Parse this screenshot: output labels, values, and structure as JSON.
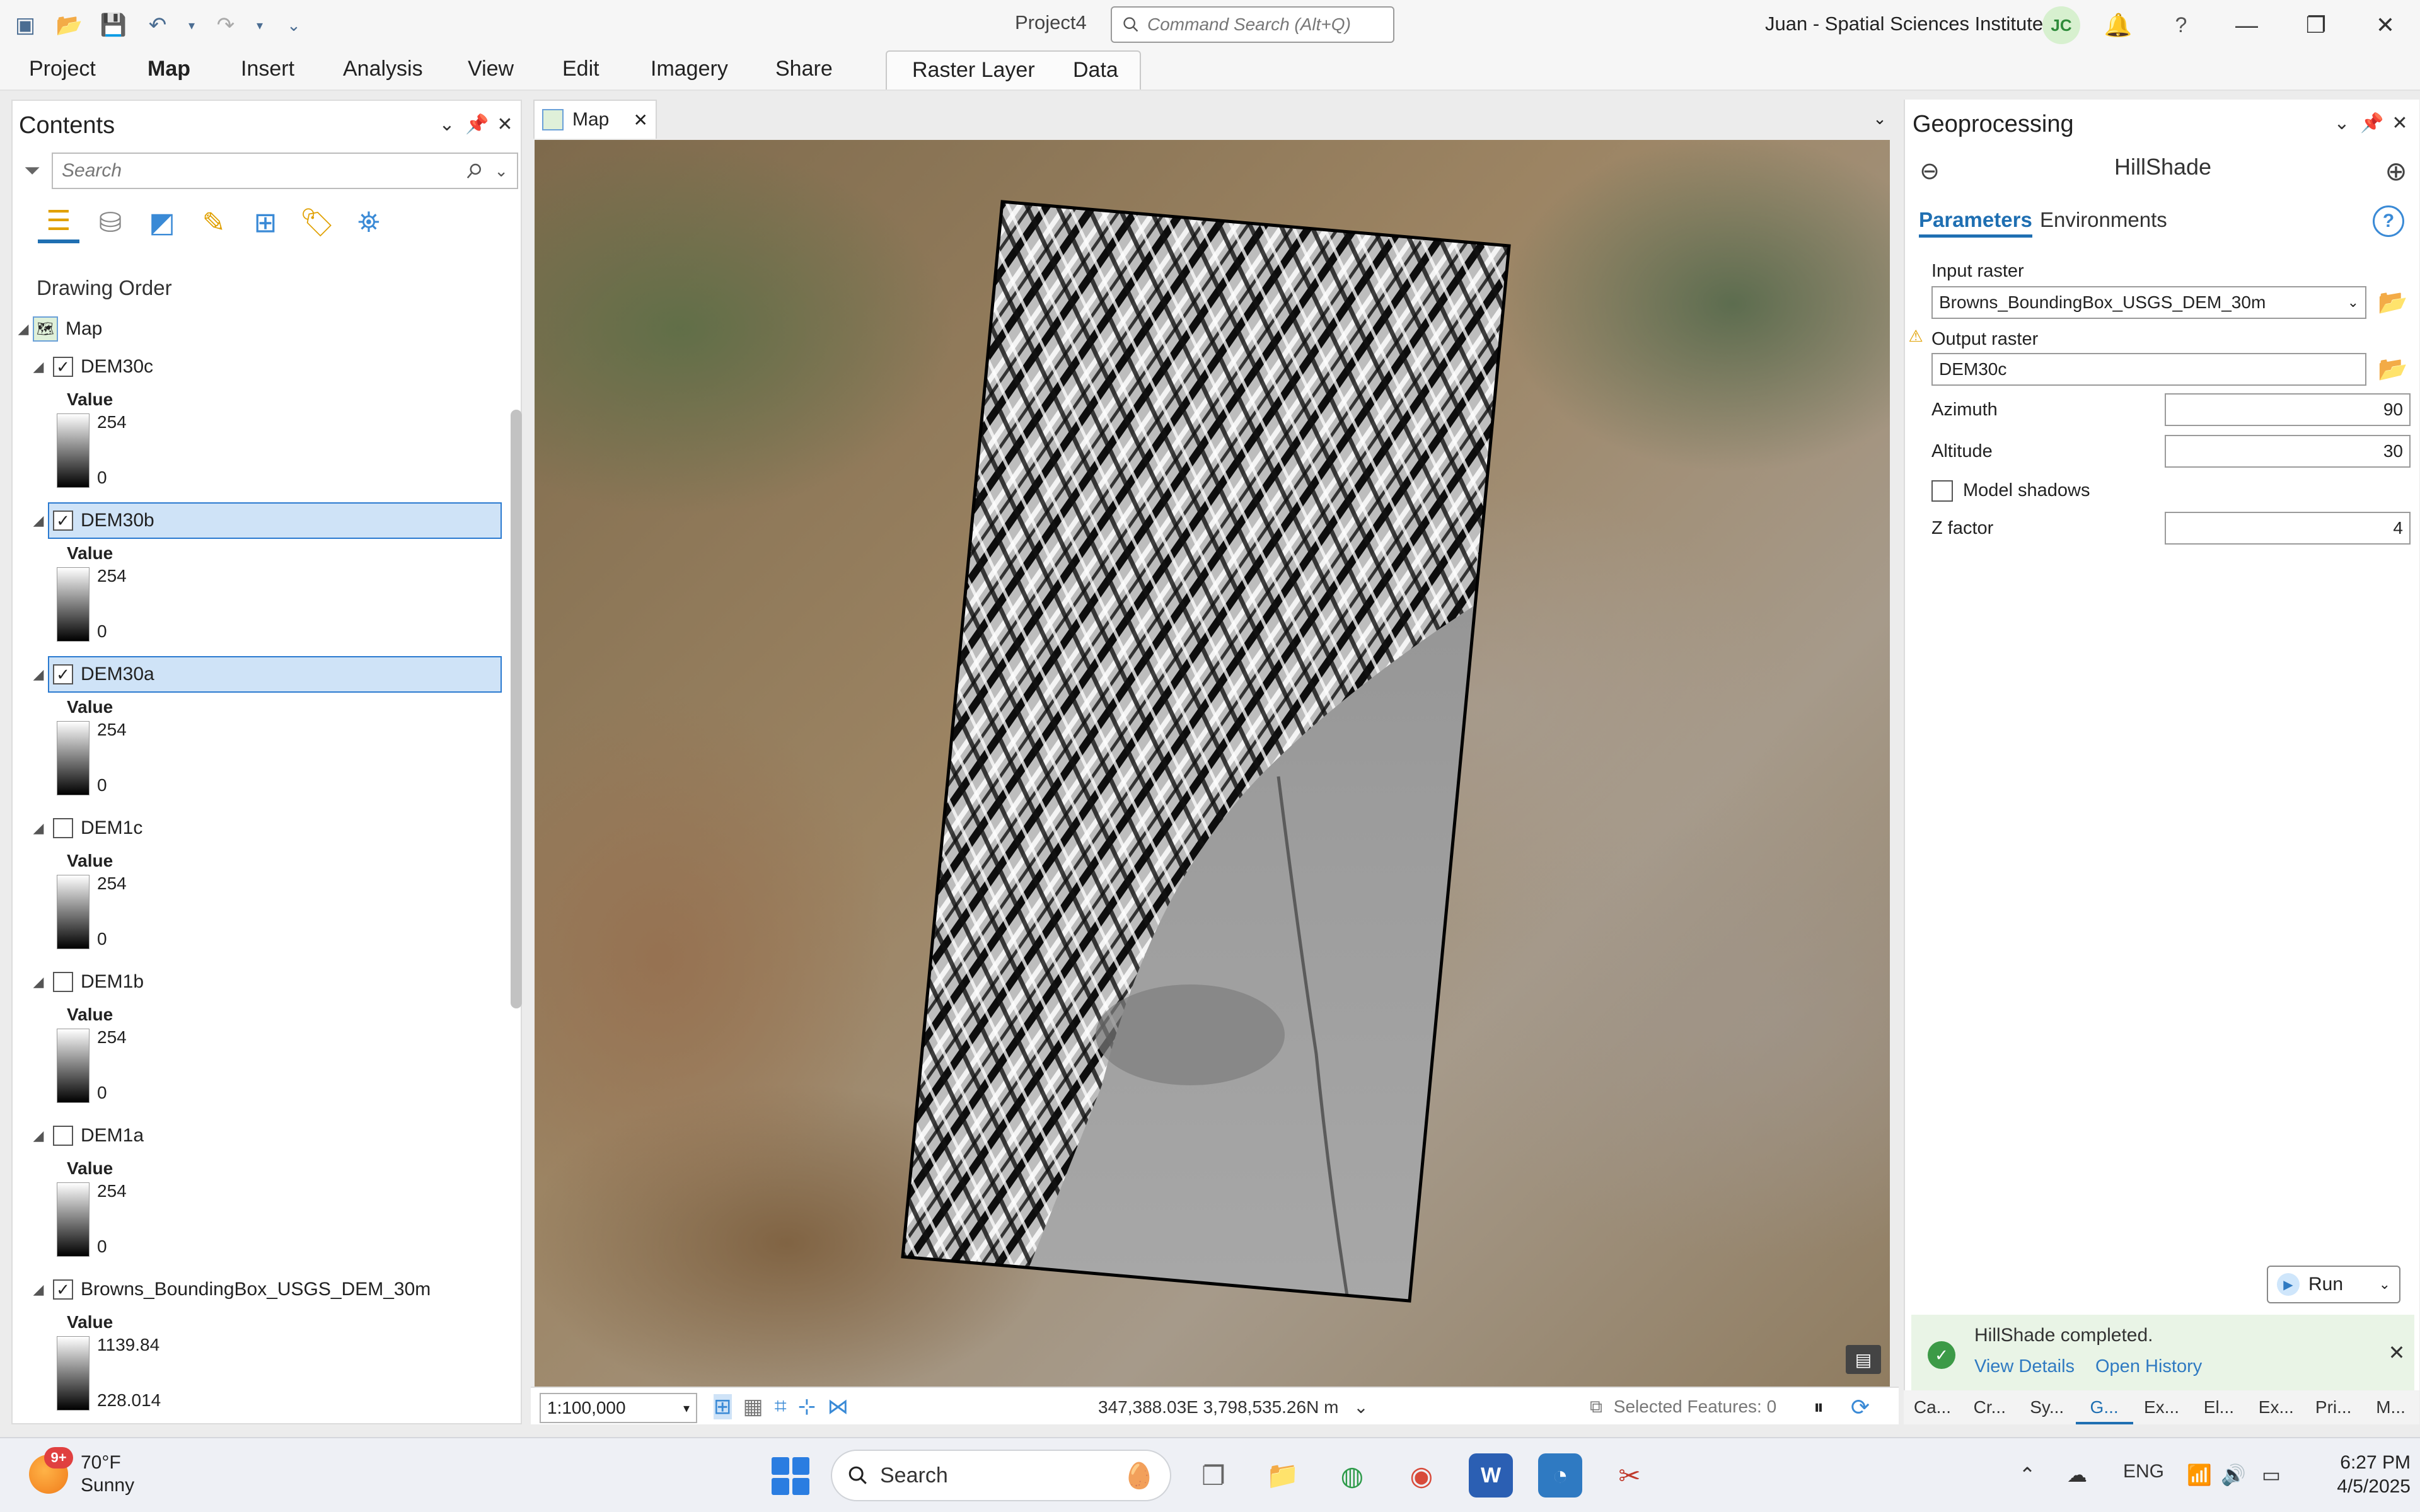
{
  "window": {
    "project_name": "Project4",
    "command_search_placeholder": "Command Search (Alt+Q)",
    "user": "Juan - Spatial Sciences Institute",
    "avatar_initials": "JC"
  },
  "ribbon": {
    "tabs": [
      "Project",
      "Map",
      "Insert",
      "Analysis",
      "View",
      "Edit",
      "Imagery",
      "Share"
    ],
    "contextual_tabs": [
      "Raster Layer",
      "Data"
    ],
    "active": "Map"
  },
  "contents": {
    "title": "Contents",
    "search_placeholder": "Search",
    "section": "Drawing Order",
    "root": "Map",
    "layers": [
      {
        "name": "DEM30c",
        "checked": true,
        "selected": false,
        "legend_label": "Value",
        "high": "254",
        "low": "0"
      },
      {
        "name": "DEM30b",
        "checked": true,
        "selected": true,
        "legend_label": "Value",
        "high": "254",
        "low": "0"
      },
      {
        "name": "DEM30a",
        "checked": true,
        "selected": true,
        "legend_label": "Value",
        "high": "254",
        "low": "0"
      },
      {
        "name": "DEM1c",
        "checked": false,
        "selected": false,
        "legend_label": "Value",
        "high": "254",
        "low": "0"
      },
      {
        "name": "DEM1b",
        "checked": false,
        "selected": false,
        "legend_label": "Value",
        "high": "254",
        "low": "0"
      },
      {
        "name": "DEM1a",
        "checked": false,
        "selected": false,
        "legend_label": "Value",
        "high": "254",
        "low": "0"
      },
      {
        "name": "Browns_BoundingBox_USGS_DEM_30m",
        "checked": true,
        "selected": false,
        "legend_label": "Value",
        "high": "1139.84",
        "low": "228.014"
      }
    ]
  },
  "map": {
    "tab_label": "Map",
    "scale": "1:100,000",
    "coordinates": "347,388.03E 3,798,535.26N m",
    "selected_features": "Selected Features: 0"
  },
  "geoprocessing": {
    "title": "Geoprocessing",
    "tool": "HillShade",
    "tab_parameters": "Parameters",
    "tab_environments": "Environments",
    "input_raster_label": "Input raster",
    "input_raster_value": "Browns_BoundingBox_USGS_DEM_30m",
    "output_raster_label": "Output raster",
    "output_raster_value": "DEM30c",
    "azimuth_label": "Azimuth",
    "azimuth_value": "90",
    "altitude_label": "Altitude",
    "altitude_value": "30",
    "model_shadows_label": "Model shadows",
    "z_factor_label": "Z factor",
    "z_factor_value": "4",
    "run_label": "Run",
    "completed_message": "HillShade completed.",
    "view_details": "View Details",
    "open_history": "Open History"
  },
  "pane_tabs": [
    "Ca...",
    "Cr...",
    "Sy...",
    "G...",
    "Ex...",
    "El...",
    "Ex...",
    "Pri...",
    "M..."
  ],
  "taskbar": {
    "weather_badge": "9+",
    "temperature": "70°F",
    "condition": "Sunny",
    "search_label": "Search",
    "language": "ENG",
    "time": "6:27 PM",
    "date": "4/5/2025"
  }
}
